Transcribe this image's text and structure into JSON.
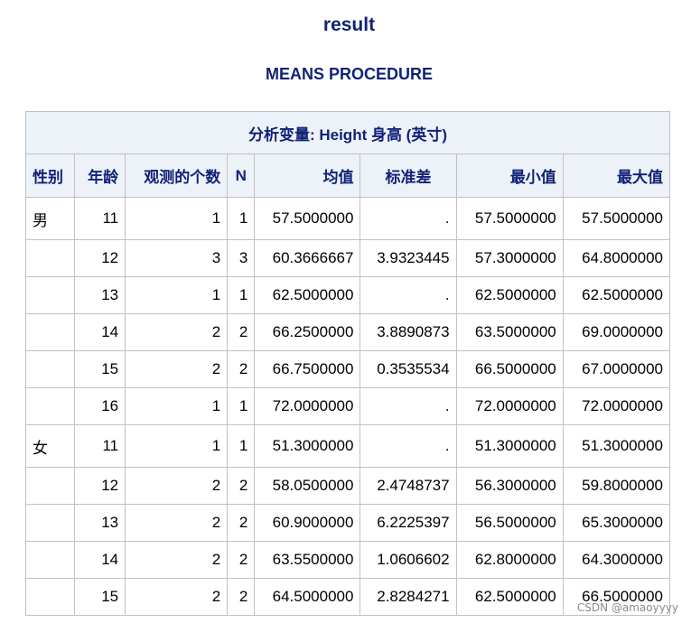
{
  "page": {
    "title": "result",
    "subtitle": "MEANS PROCEDURE",
    "watermark": "CSDN @amaoyyyy"
  },
  "colors": {
    "title_text": "#112277",
    "header_background": "#edf2f9",
    "grid_border": "#c1c1c1"
  },
  "table": {
    "caption": "分析变量: Height 身高 (英寸)",
    "columns": [
      "性别",
      "年龄",
      "观测的个数",
      "N",
      "均值",
      "标准差",
      "最小值",
      "最大值"
    ],
    "rows": [
      {
        "sex": "男",
        "age": "11",
        "nobs": "1",
        "n": "1",
        "mean": "57.5000000",
        "std": ".",
        "min": "57.5000000",
        "max": "57.5000000"
      },
      {
        "sex": "",
        "age": "12",
        "nobs": "3",
        "n": "3",
        "mean": "60.3666667",
        "std": "3.9323445",
        "min": "57.3000000",
        "max": "64.8000000"
      },
      {
        "sex": "",
        "age": "13",
        "nobs": "1",
        "n": "1",
        "mean": "62.5000000",
        "std": ".",
        "min": "62.5000000",
        "max": "62.5000000"
      },
      {
        "sex": "",
        "age": "14",
        "nobs": "2",
        "n": "2",
        "mean": "66.2500000",
        "std": "3.8890873",
        "min": "63.5000000",
        "max": "69.0000000"
      },
      {
        "sex": "",
        "age": "15",
        "nobs": "2",
        "n": "2",
        "mean": "66.7500000",
        "std": "0.3535534",
        "min": "66.5000000",
        "max": "67.0000000"
      },
      {
        "sex": "",
        "age": "16",
        "nobs": "1",
        "n": "1",
        "mean": "72.0000000",
        "std": ".",
        "min": "72.0000000",
        "max": "72.0000000"
      },
      {
        "sex": "女",
        "age": "11",
        "nobs": "1",
        "n": "1",
        "mean": "51.3000000",
        "std": ".",
        "min": "51.3000000",
        "max": "51.3000000"
      },
      {
        "sex": "",
        "age": "12",
        "nobs": "2",
        "n": "2",
        "mean": "58.0500000",
        "std": "2.4748737",
        "min": "56.3000000",
        "max": "59.8000000"
      },
      {
        "sex": "",
        "age": "13",
        "nobs": "2",
        "n": "2",
        "mean": "60.9000000",
        "std": "6.2225397",
        "min": "56.5000000",
        "max": "65.3000000"
      },
      {
        "sex": "",
        "age": "14",
        "nobs": "2",
        "n": "2",
        "mean": "63.5500000",
        "std": "1.0606602",
        "min": "62.8000000",
        "max": "64.3000000"
      },
      {
        "sex": "",
        "age": "15",
        "nobs": "2",
        "n": "2",
        "mean": "64.5000000",
        "std": "2.8284271",
        "min": "62.5000000",
        "max": "66.5000000"
      }
    ]
  }
}
